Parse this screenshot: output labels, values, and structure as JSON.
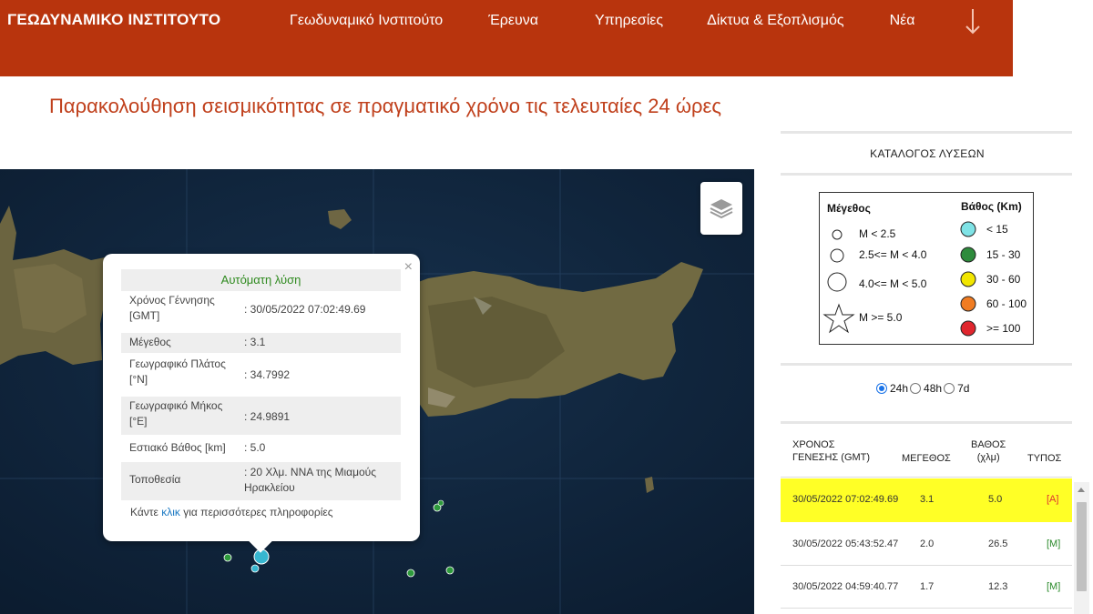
{
  "header": {
    "brand": "ΓΕΩΔΥΝΑΜΙΚΟ ΙΝΣΤΙΤΟΥΤΟ",
    "nav": [
      "Γεωδυναμικό Ινστιτούτο",
      "Έρευνα",
      "Υπηρεσίες",
      "Δίκτυα & Εξοπλισμός",
      "Νέα"
    ],
    "bg_color": "#b8340d"
  },
  "page_title": "Παρακολούθηση σεισμικότητας σε πραγματικό χρόνο τις τελευταίες 24 ώρες",
  "popup": {
    "header": "Αυτόματη λύση",
    "rows": [
      {
        "label": "Χρόνος Γέννησης [GMT]",
        "value": ": 30/05/2022 07:02:49.69"
      },
      {
        "label": "Μέγεθος",
        "value": ": 3.1"
      },
      {
        "label": "Γεωγραφικό Πλάτος [°N]",
        "value": ": 34.7992"
      },
      {
        "label": "Γεωγραφικό Μήκος [°E]",
        "value": ": 24.9891"
      },
      {
        "label": "Εστιακό Βάθος [km]",
        "value": ": 5.0"
      },
      {
        "label": "Τοποθεσία",
        "value": ": 20 Χλμ. ΝΝΑ της Μιαμούς Ηρακλείου"
      }
    ],
    "footer_pre": "Κάντε ",
    "footer_link": "κλικ",
    "footer_post": " για περισσότερες πληροφορίες",
    "close_symbol": "×"
  },
  "panel": {
    "title": "ΚΑΤΑΛΟΓΟΣ ΛΥΣΕΩΝ",
    "legend": {
      "magnitude_title": "Μέγεθος",
      "magnitude_items": [
        "M < 2.5",
        "2.5<= M < 4.0",
        "4.0<= M < 5.0",
        "M >= 5.0"
      ],
      "depth_title": "Βάθος (Km)",
      "depth_items": [
        {
          "label": "< 15",
          "color": "#7fe3e6"
        },
        {
          "label": "15 - 30",
          "color": "#2e8b3c"
        },
        {
          "label": "30 - 60",
          "color": "#f2e600"
        },
        {
          "label": "60 - 100",
          "color": "#f07c22"
        },
        {
          "label": ">= 100",
          "color": "#e0262e"
        }
      ]
    },
    "range": [
      {
        "label": "24h",
        "selected": true
      },
      {
        "label": "48h",
        "selected": false
      },
      {
        "label": "7d",
        "selected": false
      }
    ],
    "table": {
      "headers": {
        "time_l1": "ΧΡΟΝΟΣ",
        "time_l2": "ΓΕΝΕΣΗΣ (GMT)",
        "mag": "ΜΕΓΕΘΟΣ",
        "depth_l1": "ΒΑΘΟΣ",
        "depth_l2": "(χλμ)",
        "type": "ΤΥΠΟΣ"
      },
      "rows": [
        {
          "time": "30/05/2022 07:02:49.69",
          "mag": "3.1",
          "depth": "5.0",
          "type": "[A]"
        },
        {
          "time": "30/05/2022 05:43:52.47",
          "mag": "2.0",
          "depth": "26.5",
          "type": "[M]"
        },
        {
          "time": "30/05/2022 04:59:40.77",
          "mag": "1.7",
          "depth": "12.3",
          "type": "[M]"
        }
      ]
    }
  }
}
